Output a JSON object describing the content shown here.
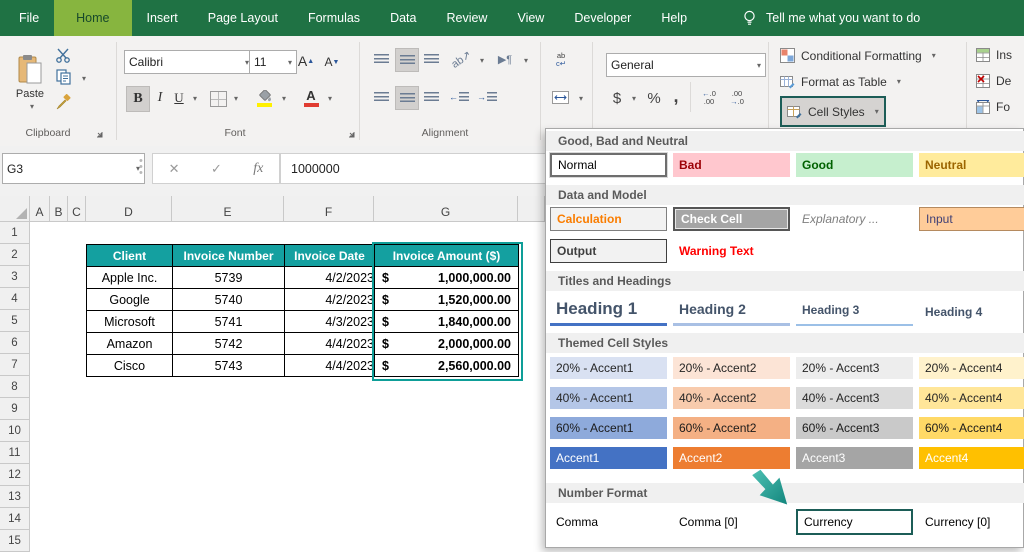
{
  "ribbon": {
    "tabs": [
      {
        "label": "File",
        "active": false
      },
      {
        "label": "Home",
        "active": true
      },
      {
        "label": "Insert",
        "active": false
      },
      {
        "label": "Page Layout",
        "active": false
      },
      {
        "label": "Formulas",
        "active": false
      },
      {
        "label": "Data",
        "active": false
      },
      {
        "label": "Review",
        "active": false
      },
      {
        "label": "View",
        "active": false
      },
      {
        "label": "Developer",
        "active": false
      },
      {
        "label": "Help",
        "active": false
      }
    ],
    "tell_me": "Tell me what you want to do",
    "clipboard": {
      "label": "Clipboard",
      "paste": "Paste"
    },
    "font": {
      "label": "Font",
      "name": "Calibri",
      "size": "11"
    },
    "alignment": {
      "label": "Alignment"
    },
    "number": {
      "format": "General"
    },
    "styles": {
      "conditional_formatting": "Conditional Formatting",
      "format_as_table": "Format as Table",
      "cell_styles": "Cell Styles"
    },
    "cells": {
      "insert": "Ins",
      "delete": "De",
      "format": "Fo"
    }
  },
  "formula_bar": {
    "name_box": "G3",
    "value": "1000000",
    "fx": "fx"
  },
  "sheet": {
    "columns": [
      "A",
      "B",
      "C",
      "D",
      "E",
      "F",
      "G"
    ],
    "rows": [
      "1",
      "2",
      "3",
      "4",
      "5",
      "6",
      "7",
      "8",
      "9",
      "10",
      "11",
      "12",
      "13",
      "14",
      "15"
    ]
  },
  "invoice_table": {
    "headers": [
      "Client",
      "Invoice Number",
      "Invoice Date",
      "Invoice Amount ($)"
    ],
    "currency_symbol": "$",
    "rows": [
      {
        "client": "Apple Inc.",
        "number": "5739",
        "date": "4/2/2023",
        "amount": "1,000,000.00"
      },
      {
        "client": "Google",
        "number": "5740",
        "date": "4/2/2023",
        "amount": "1,520,000.00"
      },
      {
        "client": "Microsoft",
        "number": "5741",
        "date": "4/3/2023",
        "amount": "1,840,000.00"
      },
      {
        "client": "Amazon",
        "number": "5742",
        "date": "4/4/2023",
        "amount": "2,000,000.00"
      },
      {
        "client": "Cisco",
        "number": "5743",
        "date": "4/4/2023",
        "amount": "2,560,000.00"
      }
    ],
    "header_bg": "#14A0A0",
    "selection_color": "#0E9E98"
  },
  "cell_styles_menu": {
    "sections": [
      {
        "title": "Good, Bad and Neutral",
        "rows": [
          [
            {
              "label": "Normal",
              "cls": "normal-sel",
              "fg": "#000000"
            },
            {
              "label": "Bad",
              "bg": "#FFC7CE",
              "fg": "#9C0006",
              "fw": "600"
            },
            {
              "label": "Good",
              "bg": "#C6EFCE",
              "fg": "#006100",
              "fw": "600"
            },
            {
              "label": "Neutral",
              "bg": "#FFEB9C",
              "fg": "#9C6500",
              "fw": "600"
            }
          ]
        ]
      },
      {
        "title": "Data and Model",
        "rows": [
          [
            {
              "label": "Calculation",
              "bg": "#F2F2F2",
              "fg": "#FA7D00",
              "bd": "1px solid #7F7F7F",
              "fw": "bold"
            },
            {
              "label": "Check Cell",
              "cls": "checkcell",
              "bg": "#A5A5A5",
              "fg": "#FFFFFF",
              "bd": "2px solid #565656",
              "fw": "bold"
            },
            {
              "label": "Explanatory ...",
              "fg": "#7F7F7F",
              "it": true
            },
            {
              "label": "Input",
              "bg": "#FFCC99",
              "fg": "#3F3F76",
              "bd": "1px solid #B58A5F"
            }
          ],
          [
            {
              "label": "Output",
              "bg": "#F2F2F2",
              "fg": "#3F3F3F",
              "bd": "1px solid #3F3F3F",
              "fw": "bold"
            },
            {
              "label": "Warning Text",
              "fg": "#FF0000",
              "fw": "600"
            }
          ]
        ]
      },
      {
        "title": "Titles and Headings",
        "rows": [
          [
            {
              "label": "Heading 1",
              "fg": "#44546A",
              "fs": "17",
              "fw": "bold",
              "ul": "3px solid #4472C4"
            },
            {
              "label": "Heading 2",
              "fg": "#44546A",
              "fs": "14",
              "fw": "bold",
              "ul": "3px solid #A9C0E4"
            },
            {
              "label": "Heading 3",
              "fg": "#44546A",
              "fs": "12",
              "fw": "bold",
              "ul": "2px solid #9CC0E7"
            },
            {
              "label": "Heading 4",
              "fg": "#44546A",
              "fs": "12",
              "fw": "bold"
            }
          ]
        ]
      },
      {
        "title": "Themed Cell Styles",
        "rows": [
          [
            {
              "label": "20% - Accent1",
              "bg": "#D9E1F2",
              "fg": "#262626"
            },
            {
              "label": "20% - Accent2",
              "bg": "#FCE4D6",
              "fg": "#262626"
            },
            {
              "label": "20% - Accent3",
              "bg": "#EDEDED",
              "fg": "#262626"
            },
            {
              "label": "20% - Accent4",
              "bg": "#FFF2CC",
              "fg": "#262626"
            }
          ],
          [
            {
              "label": "40% - Accent1",
              "bg": "#B4C6E7",
              "fg": "#262626"
            },
            {
              "label": "40% - Accent2",
              "bg": "#F8CBAD",
              "fg": "#262626"
            },
            {
              "label": "40% - Accent3",
              "bg": "#DBDBDB",
              "fg": "#262626"
            },
            {
              "label": "40% - Accent4",
              "bg": "#FFE699",
              "fg": "#262626"
            }
          ],
          [
            {
              "label": "60% - Accent1",
              "bg": "#8EAADB",
              "fg": "#1a1a1a"
            },
            {
              "label": "60% - Accent2",
              "bg": "#F4B084",
              "fg": "#1a1a1a"
            },
            {
              "label": "60% - Accent3",
              "bg": "#C9C9C9",
              "fg": "#1a1a1a"
            },
            {
              "label": "60% - Accent4",
              "bg": "#FFD966",
              "fg": "#1a1a1a"
            }
          ],
          [
            {
              "label": "Accent1",
              "bg": "#4472C4",
              "fg": "#FFFFFF"
            },
            {
              "label": "Accent2",
              "bg": "#ED7D31",
              "fg": "#FFFFFF"
            },
            {
              "label": "Accent3",
              "bg": "#A5A5A5",
              "fg": "#FFFFFF"
            },
            {
              "label": "Accent4",
              "bg": "#FFC000",
              "fg": "#FFFFFF"
            }
          ]
        ]
      },
      {
        "title": "Number Format",
        "rows": [
          [
            {
              "label": "Comma",
              "fg": "#000000"
            },
            {
              "label": "Comma [0]",
              "fg": "#000000"
            },
            {
              "label": "Currency",
              "cls": "annot",
              "fg": "#000000"
            },
            {
              "label": "Currency [0]",
              "fg": "#000000"
            }
          ]
        ]
      }
    ],
    "annotation_color": "#1C5D57",
    "arrow_color": "#2AA198"
  }
}
